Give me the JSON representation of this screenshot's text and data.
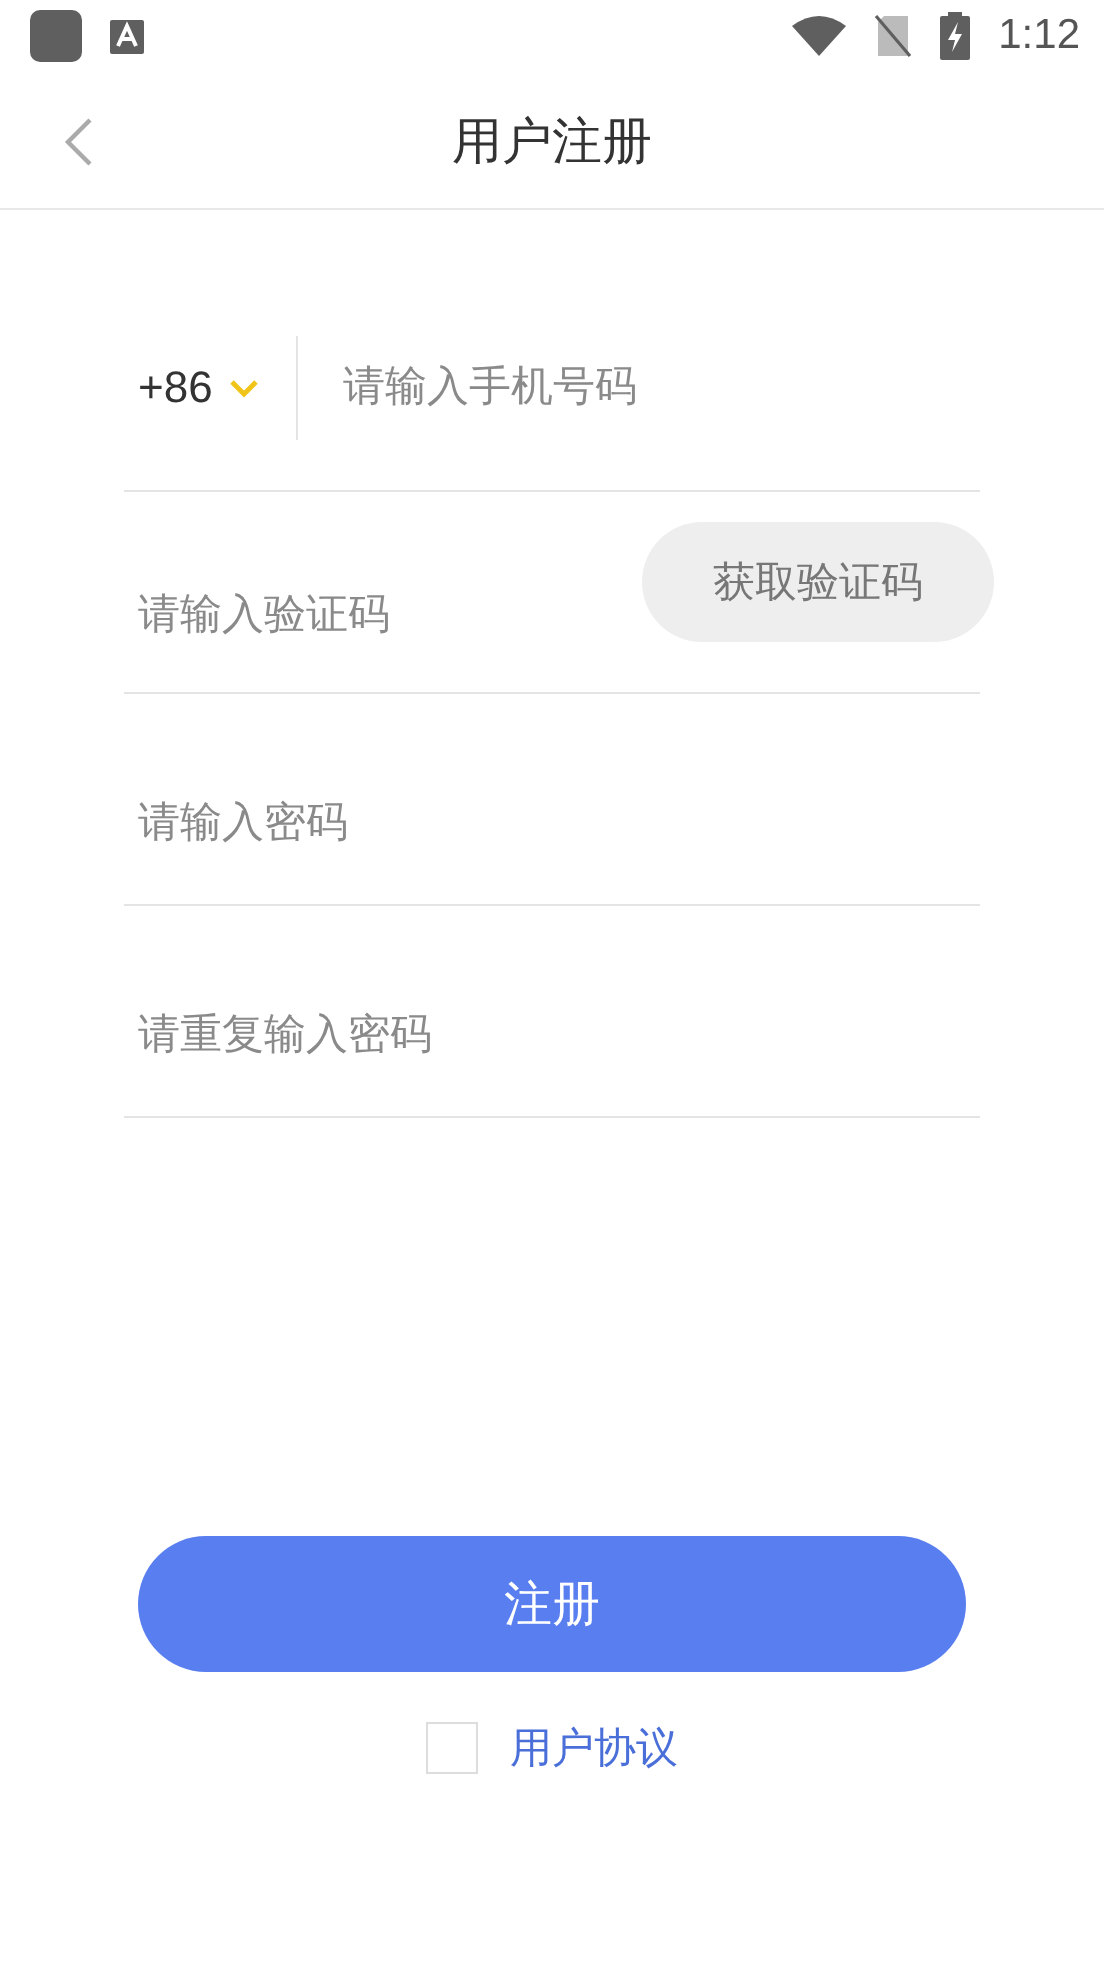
{
  "status_bar": {
    "time": "1:12"
  },
  "header": {
    "title": "用户注册"
  },
  "phone": {
    "country_code": "+86",
    "placeholder": "请输入手机号码"
  },
  "code": {
    "placeholder": "请输入验证码",
    "button": "获取验证码"
  },
  "password": {
    "placeholder": "请输入密码"
  },
  "password_repeat": {
    "placeholder": "请重复输入密码"
  },
  "submit": "注册",
  "agreement": {
    "checked": false,
    "link": "用户协议"
  }
}
